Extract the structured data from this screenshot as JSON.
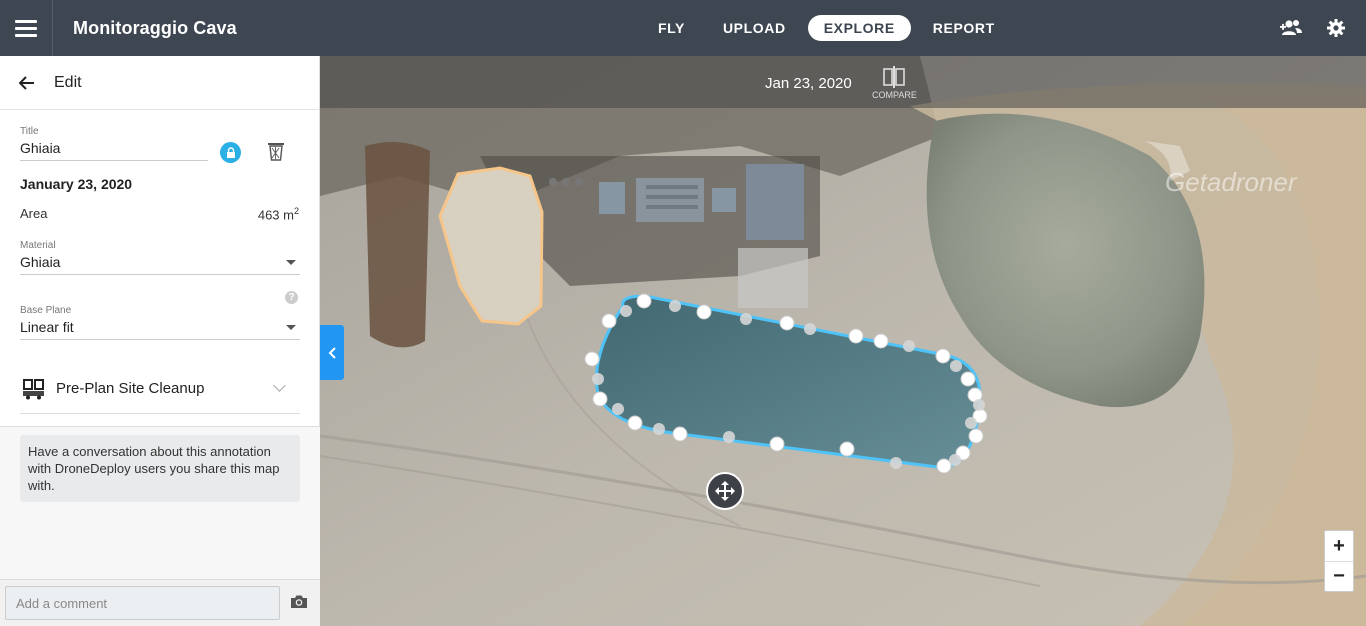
{
  "header": {
    "app_title": "Monitoraggio Cava",
    "tabs": [
      {
        "label": "FLY",
        "active": false
      },
      {
        "label": "UPLOAD",
        "active": false
      },
      {
        "label": "EXPLORE",
        "active": true
      },
      {
        "label": "REPORT",
        "active": false
      }
    ],
    "icons": [
      "menu-icon",
      "add-user-icon",
      "gear-icon"
    ]
  },
  "sidebar": {
    "title": "Edit",
    "title_field": {
      "label": "Title",
      "value": "Ghiaia"
    },
    "date": "January 23, 2020",
    "area": {
      "label": "Area",
      "value": "463 m",
      "unit_exp": "2"
    },
    "material": {
      "label": "Material",
      "value": "Ghiaia"
    },
    "base_plane": {
      "label": "Base Plane",
      "value": "Linear fit"
    },
    "plan": {
      "label": "Pre-Plan Site Cleanup"
    },
    "conversation_text": "Have a conversation about this annotation with DroneDeploy users you share this map with.",
    "comment_placeholder": "Add a comment"
  },
  "map": {
    "date": "Jan 23, 2020",
    "compare_label": "COMPARE",
    "zoom_in": "+",
    "zoom_out": "−",
    "watermark": "Getadroner",
    "colors": {
      "polygon_outline": "#4fc3f7",
      "stockpile_outline": "#f5c58a",
      "accent": "#2196f3"
    }
  }
}
